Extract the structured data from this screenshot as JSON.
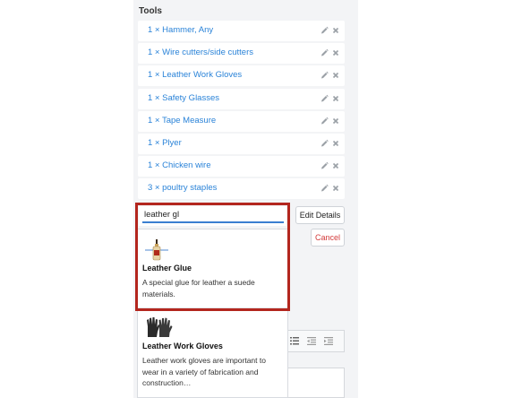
{
  "tools_section": {
    "title": "Tools",
    "items": [
      {
        "label": "1 × Hammer, Any"
      },
      {
        "label": "1 × Wire cutters/side cutters"
      },
      {
        "label": "1 × Leather Work Gloves"
      },
      {
        "label": "1 × Safety Glasses"
      },
      {
        "label": "1 × Tape Measure"
      },
      {
        "label": "1 × Plyer"
      },
      {
        "label": "1 × Chicken wire"
      },
      {
        "label": "3 × poultry staples"
      }
    ],
    "edit_icon": "pencil-icon",
    "remove_icon": "close-icon"
  },
  "search": {
    "value": "leather gl"
  },
  "buttons": {
    "edit_details": "Edit Details",
    "cancel": "Cancel"
  },
  "results": [
    {
      "name": "Leather Glue",
      "description": "A special glue for leather a suede materials.",
      "icon": "glue-bottle-icon"
    },
    {
      "name": "Leather Work Gloves",
      "description": "Leather work gloves are important to wear in a variety of fabrication and construction…",
      "icon": "gloves-icon"
    }
  ],
  "editor_toolbar": {
    "icons": [
      "bulleted-list-icon",
      "outdent-icon",
      "indent-icon"
    ]
  },
  "colors": {
    "link": "#2a83d8",
    "highlight": "#b3261e",
    "cancel": "#d33a3a",
    "focus": "#3b7fd1"
  }
}
